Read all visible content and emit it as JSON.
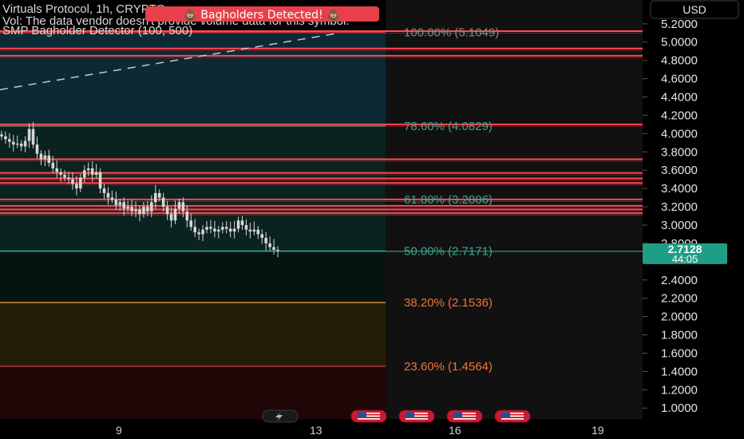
{
  "header": {
    "symbol_line": "Virtuals Protocol, 1h, CRYPTO",
    "vol_line": "Vol: The data vendor doesn't provide volume data for this symbol.",
    "indicator_line": "SMP Bagholder Detector (100, 500)",
    "alert_badge": "💩 Bagholders Detected! 💩"
  },
  "currency_button": "USD",
  "price_label": {
    "price": "2.7128",
    "countdown": "44:05"
  },
  "colors": {
    "background": "#000000",
    "fib_zone_top": "#0c2a36",
    "fib_zone_mid": "#0a2220",
    "fib_zone_low": "#241c06",
    "fib_zone_bottom": "#200707",
    "resistance_line": "#ff4a52",
    "fib_label": "#3aa58f",
    "fib_label_warm": "#f5723a",
    "price_line": "#3bb09a",
    "candle": "#d6d6d6"
  },
  "icons": {
    "bolt": "lightning-bolt-icon",
    "flag": "us-flag-icon"
  },
  "chart_data": {
    "type": "candlestick",
    "x_ticks": [
      "9",
      "13",
      "16",
      "19"
    ],
    "y_ticks": [
      "1.0000",
      "1.2000",
      "1.4000",
      "1.6000",
      "1.8000",
      "2.0000",
      "2.2000",
      "2.4000",
      "2.8000",
      "3.0000",
      "3.2000",
      "3.4000",
      "3.6000",
      "3.8000",
      "4.0000",
      "4.2000",
      "4.4000",
      "4.6000",
      "4.8000",
      "5.0000",
      "5.2000"
    ],
    "ylim": [
      0.88,
      5.46
    ],
    "current_price": 2.7128,
    "fib_levels": [
      {
        "label": "100.00% (5.1049)",
        "value": 5.1049,
        "color": "#7d8f8a"
      },
      {
        "label": "78.60% (4.0829)",
        "value": 4.0829,
        "color": "#3aa58f"
      },
      {
        "label": "61.80% (3.2806)",
        "value": 3.2806,
        "color": "#3aa58f"
      },
      {
        "label": "50.00% (2.7171)",
        "value": 2.7171,
        "color": "#3aa58f"
      },
      {
        "label": "38.20% (2.1536)",
        "value": 2.1536,
        "color": "#f5723a"
      },
      {
        "label": "23.60% (1.4564)",
        "value": 1.4564,
        "color": "#f5723a"
      }
    ],
    "resistance_levels": [
      5.12,
      4.93,
      4.85,
      4.1,
      3.72,
      3.57,
      3.51,
      3.46,
      3.28,
      3.21,
      3.17,
      3.13
    ],
    "trend_line": {
      "from": [
        0,
        4.48
      ],
      "to": [
        0.52,
        5.09
      ]
    },
    "close_series": [
      3.97,
      3.94,
      3.91,
      3.88,
      3.89,
      3.86,
      3.92,
      4.05,
      3.88,
      3.78,
      3.72,
      3.76,
      3.68,
      3.62,
      3.58,
      3.55,
      3.52,
      3.5,
      3.45,
      3.4,
      3.52,
      3.6,
      3.62,
      3.55,
      3.58,
      3.4,
      3.35,
      3.3,
      3.28,
      3.22,
      3.25,
      3.18,
      3.2,
      3.15,
      3.17,
      3.12,
      3.2,
      3.15,
      3.25,
      3.35,
      3.3,
      3.2,
      3.12,
      3.05,
      3.18,
      3.25,
      3.15,
      3.05,
      2.98,
      2.92,
      2.9,
      2.95,
      2.98,
      2.96,
      2.93,
      2.95,
      2.98,
      2.96,
      2.93,
      2.96,
      3.05,
      3.0,
      2.95,
      2.93,
      2.95,
      2.9,
      2.86,
      2.8,
      2.76,
      2.73,
      2.7128
    ]
  }
}
